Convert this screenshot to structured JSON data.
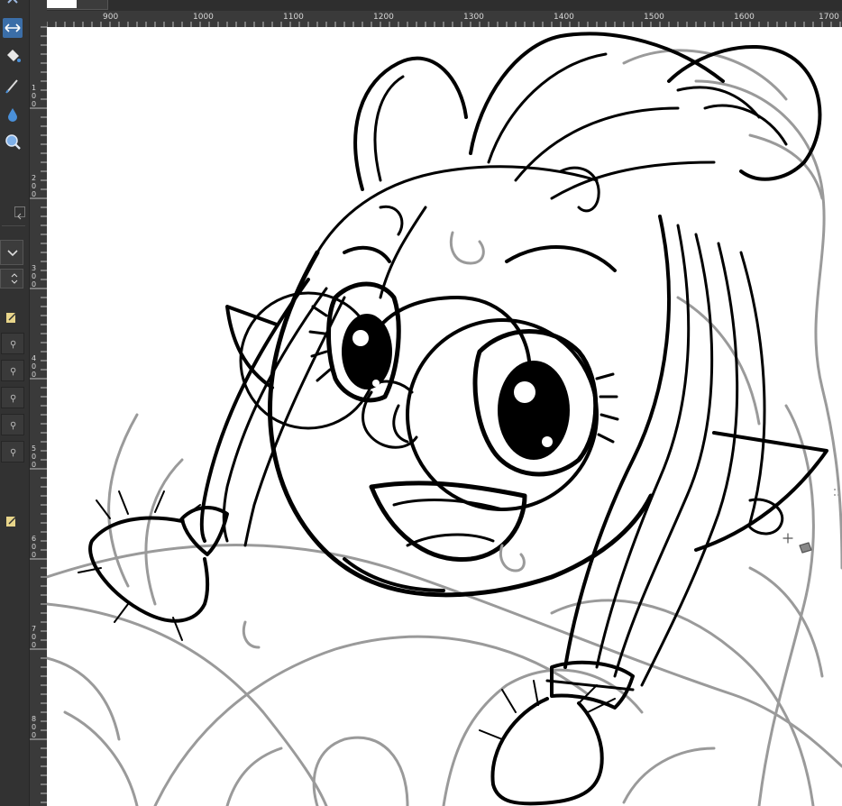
{
  "app": {
    "document_tab": ""
  },
  "ruler": {
    "top_labels": [
      "900",
      "1000",
      "1100",
      "1200",
      "1300",
      "1400",
      "1500",
      "1600",
      "1700"
    ],
    "left_labels": [
      "100",
      "200",
      "300",
      "400",
      "500",
      "600",
      "700",
      "800"
    ]
  },
  "toolbox": {
    "tools": [
      "move-tool-icon",
      "fill-bucket-icon",
      "pen-icon",
      "ink-drop-icon",
      "zoom-icon"
    ],
    "active_tool": "move-tool-icon"
  },
  "colors": {
    "ui_bg": "#323232",
    "ruler_bg": "#3a3a3a",
    "accent": "#3b6ea8",
    "canvas": "#ffffff",
    "ink": "#000000",
    "sketch": "#9a9a9a"
  }
}
